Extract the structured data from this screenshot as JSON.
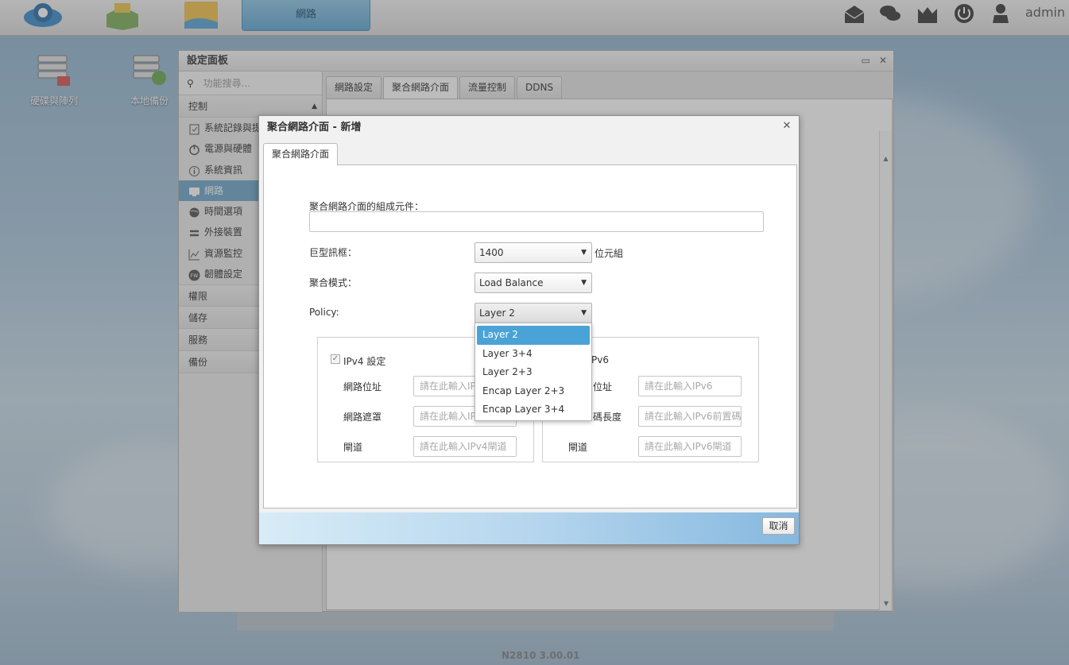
{
  "topbar": {
    "active_tab": "網路",
    "user": "admin"
  },
  "desktop": {
    "icons": [
      {
        "label": "硬碟與陣列"
      },
      {
        "label": "本地備份"
      }
    ]
  },
  "settings": {
    "title": "設定面板",
    "search_placeholder": "功能搜尋...",
    "sections": {
      "control": "控制",
      "permissions": "權限",
      "storage": "儲存",
      "services": "服務",
      "backup": "備份"
    },
    "items": [
      {
        "label": "系統記錄與提"
      },
      {
        "label": "電源與硬體"
      },
      {
        "label": "系統資訊"
      },
      {
        "label": "網路"
      },
      {
        "label": "時間選項"
      },
      {
        "label": "外接裝置"
      },
      {
        "label": "資源監控"
      },
      {
        "label": "韌體設定"
      }
    ],
    "tabs": [
      "網路設定",
      "聚合網路介面",
      "流量控制",
      "DDNS"
    ]
  },
  "dialog": {
    "title": "聚合網路介面 - 新增",
    "tab": "聚合網路介面",
    "components_label": "聚合網路介面的組成元件：",
    "jumbo_label": "巨型訊框：",
    "jumbo_value": "1400",
    "jumbo_unit": "位元組",
    "mode_label": "聚合模式：",
    "mode_value": "Load Balance",
    "policy_label": "Policy:",
    "policy_value": "Layer 2",
    "policy_options": [
      "Layer 2",
      "Layer 3+4",
      "Layer 2+3",
      "Encap Layer 2+3",
      "Encap Layer 3+4"
    ],
    "ipv4": {
      "title": "IPv4 設定",
      "address_label": "網路位址",
      "address_placeholder": "請在此輸入IPv4",
      "mask_label": "網路遮罩",
      "mask_placeholder": "請在此輸入IPv4",
      "gateway_label": "閘道",
      "gateway_placeholder": "請在此輸入IPv4閘道"
    },
    "ipv6": {
      "title": "Pv6",
      "address_label": "位址",
      "address_placeholder": "請在此輸入IPv6",
      "prefix_label": "碼長度",
      "prefix_placeholder": "請在此輸入IPv6前置碼",
      "gateway_label": "閘道",
      "gateway_placeholder": "請在此輸入IPv6閘道"
    },
    "cancel": "取消"
  },
  "version": "N2810   3.00.01",
  "colors": {
    "accent": "#4aa3d6",
    "active_sidebar": "#6fa7cb"
  }
}
